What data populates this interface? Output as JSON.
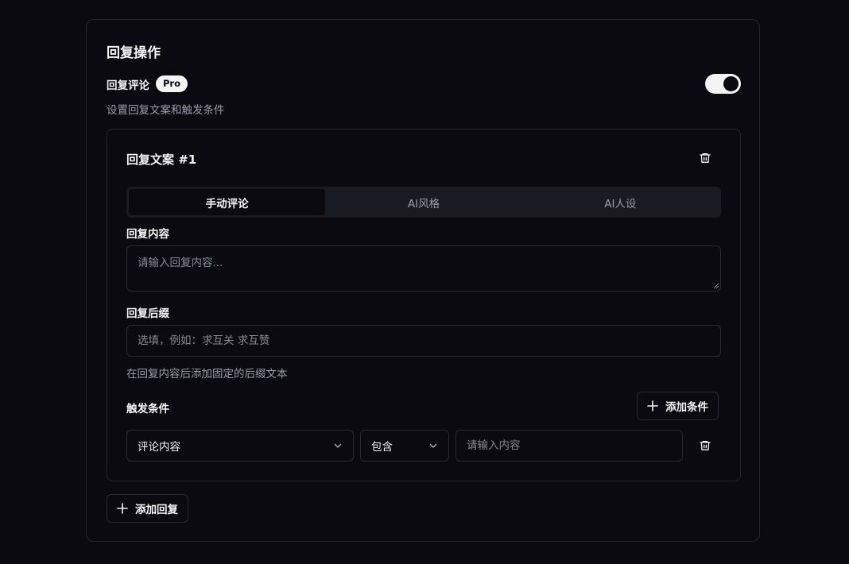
{
  "section": {
    "title": "回复操作",
    "reply_comment": {
      "label": "回复评论",
      "badge": "Pro",
      "description": "设置回复文案和触发条件",
      "enabled": true
    }
  },
  "reply_item": {
    "title": "回复文案 #1",
    "tabs": [
      {
        "label": "手动评论",
        "active": true
      },
      {
        "label": "AI风格",
        "active": false
      },
      {
        "label": "AI人设",
        "active": false
      }
    ],
    "content": {
      "label": "回复内容",
      "placeholder": "请输入回复内容...",
      "value": ""
    },
    "suffix": {
      "label": "回复后缀",
      "placeholder": "选填，例如：求互关 求互赞",
      "value": "",
      "hint": "在回复内容后添加固定的后缀文本"
    },
    "trigger": {
      "label": "触发条件",
      "add_label": "添加条件",
      "conditions": [
        {
          "field": "评论内容",
          "operator": "包含",
          "value_placeholder": "请输入内容",
          "value": ""
        }
      ]
    }
  },
  "add_reply_label": "添加回复",
  "colors": {
    "background": "#0a0a10",
    "border": "#26262e",
    "text": "#f4f4f5",
    "muted": "#9c9ca6",
    "tab_bg": "#1a1a23"
  }
}
